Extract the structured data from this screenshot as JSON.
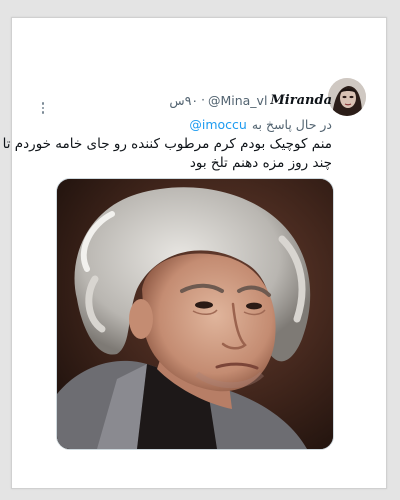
{
  "tweet": {
    "display_name": "Miranda",
    "handle": "@Mina_vl",
    "separator": "·",
    "time_ago": "۹۰س",
    "reply_prefix": "در حال پاسخ به",
    "reply_to": "@imoccu",
    "text_lines": [
      "منم کوچیک بودم کرم مرطوب کننده رو جای خامه خوردم تا",
      "چند روز مزه دهنم تلخ بود"
    ]
  },
  "colors": {
    "link": "#1d9bf0",
    "secondary_text": "#536471",
    "primary_text": "#0f1419"
  },
  "icons": {
    "more": "more-vertical-icon"
  }
}
